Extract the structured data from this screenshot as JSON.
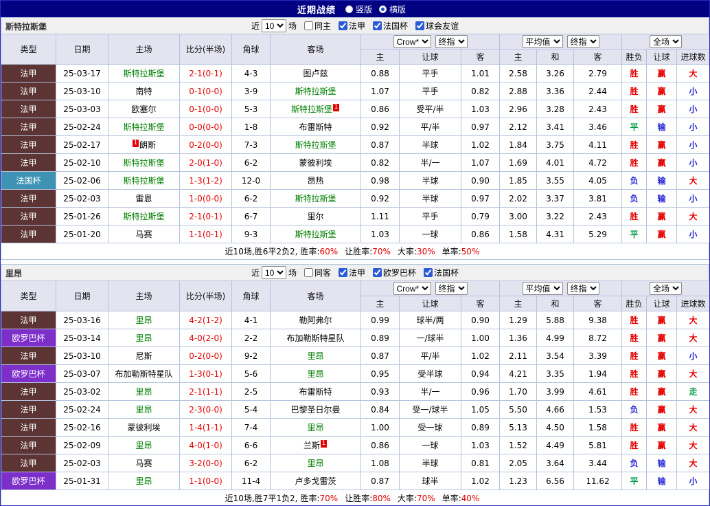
{
  "titlebar": {
    "title": "近期战绩",
    "radios": [
      {
        "label": "竖版",
        "selected": false
      },
      {
        "label": "横版",
        "selected": true
      }
    ]
  },
  "colors": {
    "navy_bar": "#010181",
    "ligue1_badge": "#5c3434",
    "coupe_badge": "#3e92b4",
    "europa_badge": "#7d2fc9",
    "focus_team": "#008000",
    "win_red": "#e60000",
    "loss_blue": "#2a2ad4",
    "draw_green": "#009944"
  },
  "table_header": {
    "static_cols": [
      "类型",
      "日期",
      "主场",
      "比分(半场)",
      "角球",
      "客场"
    ],
    "asian_selects": [
      "Crow*",
      "终指"
    ],
    "euro_selects": [
      "平均值",
      "终指"
    ],
    "scope_select": "全场",
    "sub_cols": [
      "主",
      "让球",
      "客",
      "主",
      "和",
      "客",
      "胜负",
      "让球",
      "进球数"
    ]
  },
  "sections": [
    {
      "team": "斯特拉斯堡",
      "filter": {
        "prefix": "近",
        "count": "10",
        "suffix": "场",
        "checkboxes": [
          {
            "label": "同主",
            "checked": false
          },
          {
            "label": "法甲",
            "checked": true
          },
          {
            "label": "法国杯",
            "checked": true
          },
          {
            "label": "球会友谊",
            "checked": true
          }
        ]
      },
      "rows": [
        {
          "league": "法甲",
          "date": "25-03-17",
          "home": "斯特拉斯堡",
          "home_focus": true,
          "home_card": "",
          "score": "2-1(0-1)",
          "corners": "4-3",
          "away": "图卢兹",
          "away_focus": false,
          "away_card": "",
          "asian": [
            "0.88",
            "平手",
            "1.01"
          ],
          "euro": [
            "2.58",
            "3.26",
            "2.79"
          ],
          "results": [
            "胜",
            "赢",
            "大"
          ]
        },
        {
          "league": "法甲",
          "date": "25-03-10",
          "home": "南特",
          "home_focus": false,
          "home_card": "",
          "score": "0-1(0-0)",
          "corners": "3-9",
          "away": "斯特拉斯堡",
          "away_focus": true,
          "away_card": "",
          "asian": [
            "1.07",
            "平手",
            "0.82"
          ],
          "euro": [
            "2.88",
            "3.36",
            "2.44"
          ],
          "results": [
            "胜",
            "赢",
            "小"
          ]
        },
        {
          "league": "法甲",
          "date": "25-03-03",
          "home": "欧塞尔",
          "home_focus": false,
          "home_card": "",
          "score": "0-1(0-0)",
          "corners": "5-3",
          "away": "斯特拉斯堡",
          "away_focus": true,
          "away_card": "suf",
          "asian": [
            "0.86",
            "受平/半",
            "1.03"
          ],
          "euro": [
            "2.96",
            "3.28",
            "2.43"
          ],
          "results": [
            "胜",
            "赢",
            "小"
          ]
        },
        {
          "league": "法甲",
          "date": "25-02-24",
          "home": "斯特拉斯堡",
          "home_focus": true,
          "home_card": "",
          "score": "0-0(0-0)",
          "corners": "1-8",
          "away": "布雷斯特",
          "away_focus": false,
          "away_card": "",
          "asian": [
            "0.92",
            "平/半",
            "0.97"
          ],
          "euro": [
            "2.12",
            "3.41",
            "3.46"
          ],
          "results": [
            "平",
            "输",
            "小"
          ]
        },
        {
          "league": "法甲",
          "date": "25-02-17",
          "home": "朗斯",
          "home_focus": false,
          "home_card": "pre",
          "score": "0-2(0-0)",
          "corners": "7-3",
          "away": "斯特拉斯堡",
          "away_focus": true,
          "away_card": "",
          "asian": [
            "0.87",
            "半球",
            "1.02"
          ],
          "euro": [
            "1.84",
            "3.75",
            "4.11"
          ],
          "results": [
            "胜",
            "赢",
            "小"
          ]
        },
        {
          "league": "法甲",
          "date": "25-02-10",
          "home": "斯特拉斯堡",
          "home_focus": true,
          "home_card": "",
          "score": "2-0(1-0)",
          "corners": "6-2",
          "away": "蒙彼利埃",
          "away_focus": false,
          "away_card": "",
          "asian": [
            "0.82",
            "半/一",
            "1.07"
          ],
          "euro": [
            "1.69",
            "4.01",
            "4.72"
          ],
          "results": [
            "胜",
            "赢",
            "小"
          ]
        },
        {
          "league": "法国杯",
          "date": "25-02-06",
          "home": "斯特拉斯堡",
          "home_focus": true,
          "home_card": "",
          "score": "1-3(1-2)",
          "corners": "12-0",
          "away": "昂热",
          "away_focus": false,
          "away_card": "",
          "asian": [
            "0.98",
            "半球",
            "0.90"
          ],
          "euro": [
            "1.85",
            "3.55",
            "4.05"
          ],
          "results": [
            "负",
            "输",
            "大"
          ]
        },
        {
          "league": "法甲",
          "date": "25-02-03",
          "home": "雷恩",
          "home_focus": false,
          "home_card": "",
          "score": "1-0(0-0)",
          "corners": "6-2",
          "away": "斯特拉斯堡",
          "away_focus": true,
          "away_card": "",
          "asian": [
            "0.92",
            "半球",
            "0.97"
          ],
          "euro": [
            "2.02",
            "3.37",
            "3.81"
          ],
          "results": [
            "负",
            "输",
            "小"
          ]
        },
        {
          "league": "法甲",
          "date": "25-01-26",
          "home": "斯特拉斯堡",
          "home_focus": true,
          "home_card": "",
          "score": "2-1(0-1)",
          "corners": "6-7",
          "away": "里尔",
          "away_focus": false,
          "away_card": "",
          "asian": [
            "1.11",
            "平手",
            "0.79"
          ],
          "euro": [
            "3.00",
            "3.22",
            "2.43"
          ],
          "results": [
            "胜",
            "赢",
            "大"
          ]
        },
        {
          "league": "法甲",
          "date": "25-01-20",
          "home": "马赛",
          "home_focus": false,
          "home_card": "",
          "score": "1-1(0-1)",
          "corners": "9-3",
          "away": "斯特拉斯堡",
          "away_focus": true,
          "away_card": "",
          "asian": [
            "1.03",
            "一球",
            "0.86"
          ],
          "euro": [
            "1.58",
            "4.31",
            "5.29"
          ],
          "results": [
            "平",
            "赢",
            "小"
          ]
        }
      ],
      "summary": {
        "lead": "近10场,胜6平2负2,",
        "stats": [
          {
            "label": "胜率:",
            "value": "60%"
          },
          {
            "label": "让胜率:",
            "value": "70%"
          },
          {
            "label": "大率:",
            "value": "30%"
          },
          {
            "label": "单率:",
            "value": "50%"
          }
        ]
      }
    },
    {
      "team": "里昂",
      "filter": {
        "prefix": "近",
        "count": "10",
        "suffix": "场",
        "checkboxes": [
          {
            "label": "同客",
            "checked": false
          },
          {
            "label": "法甲",
            "checked": true
          },
          {
            "label": "欧罗巴杯",
            "checked": true
          },
          {
            "label": "法国杯",
            "checked": true
          }
        ]
      },
      "rows": [
        {
          "league": "法甲",
          "date": "25-03-16",
          "home": "里昂",
          "home_focus": true,
          "home_card": "",
          "score": "4-2(1-2)",
          "corners": "4-1",
          "away": "勒阿弗尔",
          "away_focus": false,
          "away_card": "",
          "asian": [
            "0.99",
            "球半/两",
            "0.90"
          ],
          "euro": [
            "1.29",
            "5.88",
            "9.38"
          ],
          "results": [
            "胜",
            "赢",
            "大"
          ]
        },
        {
          "league": "欧罗巴杯",
          "date": "25-03-14",
          "home": "里昂",
          "home_focus": true,
          "home_card": "",
          "score": "4-0(2-0)",
          "corners": "2-2",
          "away": "布加勒斯特星队",
          "away_focus": false,
          "away_card": "",
          "asian": [
            "0.89",
            "一/球半",
            "1.00"
          ],
          "euro": [
            "1.36",
            "4.99",
            "8.72"
          ],
          "results": [
            "胜",
            "赢",
            "大"
          ]
        },
        {
          "league": "法甲",
          "date": "25-03-10",
          "home": "尼斯",
          "home_focus": false,
          "home_card": "",
          "score": "0-2(0-0)",
          "corners": "9-2",
          "away": "里昂",
          "away_focus": true,
          "away_card": "",
          "asian": [
            "0.87",
            "平/半",
            "1.02"
          ],
          "euro": [
            "2.11",
            "3.54",
            "3.39"
          ],
          "results": [
            "胜",
            "赢",
            "小"
          ]
        },
        {
          "league": "欧罗巴杯",
          "date": "25-03-07",
          "home": "布加勒斯特星队",
          "home_focus": false,
          "home_card": "",
          "score": "1-3(0-1)",
          "corners": "5-6",
          "away": "里昂",
          "away_focus": true,
          "away_card": "",
          "asian": [
            "0.95",
            "受半球",
            "0.94"
          ],
          "euro": [
            "4.21",
            "3.35",
            "1.94"
          ],
          "results": [
            "胜",
            "赢",
            "大"
          ]
        },
        {
          "league": "法甲",
          "date": "25-03-02",
          "home": "里昂",
          "home_focus": true,
          "home_card": "",
          "score": "2-1(1-1)",
          "corners": "2-5",
          "away": "布雷斯特",
          "away_focus": false,
          "away_card": "",
          "asian": [
            "0.93",
            "半/一",
            "0.96"
          ],
          "euro": [
            "1.70",
            "3.99",
            "4.61"
          ],
          "results": [
            "胜",
            "赢",
            "走"
          ]
        },
        {
          "league": "法甲",
          "date": "25-02-24",
          "home": "里昂",
          "home_focus": true,
          "home_card": "",
          "score": "2-3(0-0)",
          "corners": "5-4",
          "away": "巴黎圣日尔曼",
          "away_focus": false,
          "away_card": "",
          "asian": [
            "0.84",
            "受一/球半",
            "1.05"
          ],
          "euro": [
            "5.50",
            "4.66",
            "1.53"
          ],
          "results": [
            "负",
            "赢",
            "大"
          ]
        },
        {
          "league": "法甲",
          "date": "25-02-16",
          "home": "蒙彼利埃",
          "home_focus": false,
          "home_card": "",
          "score": "1-4(1-1)",
          "corners": "7-4",
          "away": "里昂",
          "away_focus": true,
          "away_card": "",
          "asian": [
            "1.00",
            "受一球",
            "0.89"
          ],
          "euro": [
            "5.13",
            "4.50",
            "1.58"
          ],
          "results": [
            "胜",
            "赢",
            "大"
          ]
        },
        {
          "league": "法甲",
          "date": "25-02-09",
          "home": "里昂",
          "home_focus": true,
          "home_card": "",
          "score": "4-0(1-0)",
          "corners": "6-6",
          "away": "兰斯",
          "away_focus": false,
          "away_card": "suf",
          "asian": [
            "0.86",
            "一球",
            "1.03"
          ],
          "euro": [
            "1.52",
            "4.49",
            "5.81"
          ],
          "results": [
            "胜",
            "赢",
            "大"
          ]
        },
        {
          "league": "法甲",
          "date": "25-02-03",
          "home": "马赛",
          "home_focus": false,
          "home_card": "",
          "score": "3-2(0-0)",
          "corners": "6-2",
          "away": "里昂",
          "away_focus": true,
          "away_card": "",
          "asian": [
            "1.08",
            "半球",
            "0.81"
          ],
          "euro": [
            "2.05",
            "3.64",
            "3.44"
          ],
          "results": [
            "负",
            "输",
            "大"
          ]
        },
        {
          "league": "欧罗巴杯",
          "date": "25-01-31",
          "home": "里昂",
          "home_focus": true,
          "home_card": "",
          "score": "1-1(0-0)",
          "corners": "11-4",
          "away": "卢多戈雷茨",
          "away_focus": false,
          "away_card": "",
          "asian": [
            "0.87",
            "球半",
            "1.02"
          ],
          "euro": [
            "1.23",
            "6.56",
            "11.62"
          ],
          "results": [
            "平",
            "输",
            "小"
          ]
        }
      ],
      "summary": {
        "lead": "近10场,胜7平1负2,",
        "stats": [
          {
            "label": "胜率:",
            "value": "70%"
          },
          {
            "label": "让胜率:",
            "value": "80%"
          },
          {
            "label": "大率:",
            "value": "70%"
          },
          {
            "label": "单率:",
            "value": "40%"
          }
        ]
      }
    }
  ]
}
